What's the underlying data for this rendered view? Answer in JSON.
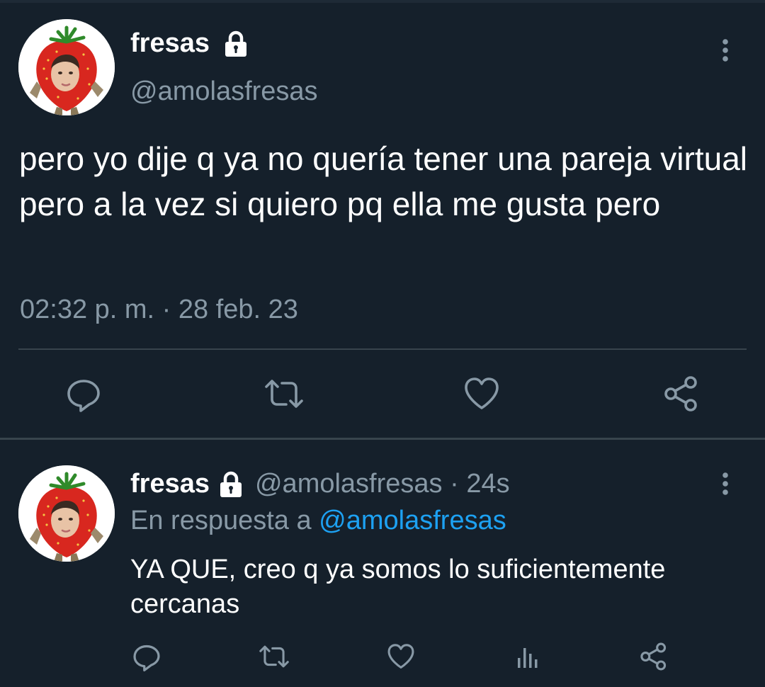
{
  "main_tweet": {
    "author_name": "fresas",
    "handle": "@amolasfresas",
    "text": "pero yo dije q ya no quería tener una pareja virtual pero a la vez si quiero pq ella me gusta pero",
    "timestamp": "02:32 p. m. · 28 feb. 23",
    "protected_icon": "lock-icon",
    "actions": [
      "reply-icon",
      "retweet-icon",
      "like-icon",
      "share-icon"
    ]
  },
  "reply_tweet": {
    "author_name": "fresas",
    "handle": "@amolasfresas",
    "time_sep": " · ",
    "relative_time": "24s",
    "replying_prefix": "En respuesta a ",
    "replying_to": "@amolasfresas",
    "text": "YA QUE, creo q ya somos lo suficientemente cercanas",
    "actions": [
      "reply-icon",
      "retweet-icon",
      "like-icon",
      "stats-icon",
      "share-icon"
    ]
  },
  "colors": {
    "background": "#15202b",
    "secondary_text": "#8899a6",
    "accent": "#1da1f2",
    "divider": "#38444d"
  }
}
